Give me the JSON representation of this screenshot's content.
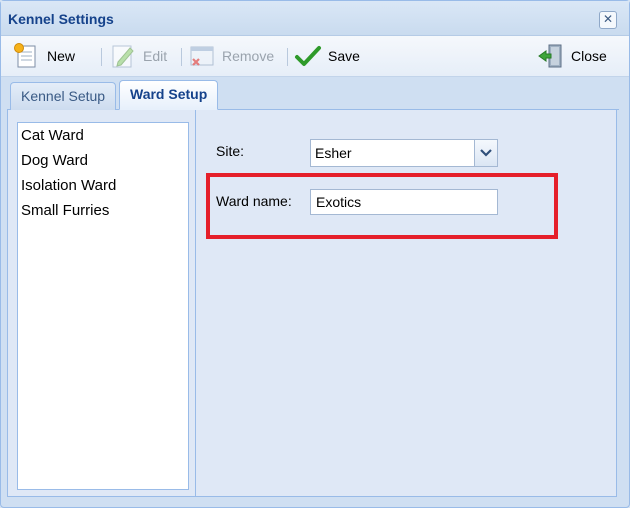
{
  "window": {
    "title": "Kennel Settings"
  },
  "toolbar": {
    "new_label": "New",
    "edit_label": "Edit",
    "remove_label": "Remove",
    "save_label": "Save",
    "close_label": "Close"
  },
  "tabs": [
    {
      "label": "Kennel Setup",
      "active": false
    },
    {
      "label": "Ward Setup",
      "active": true
    }
  ],
  "wards": [
    "Cat Ward",
    "Dog Ward",
    "Isolation Ward",
    "Small Furries"
  ],
  "form": {
    "site_label": "Site:",
    "site_value": "Esher",
    "ward_name_label": "Ward name:",
    "ward_name_value": "Exotics"
  },
  "colors": {
    "highlight": "#e51f2a",
    "accent": "#15428b"
  }
}
